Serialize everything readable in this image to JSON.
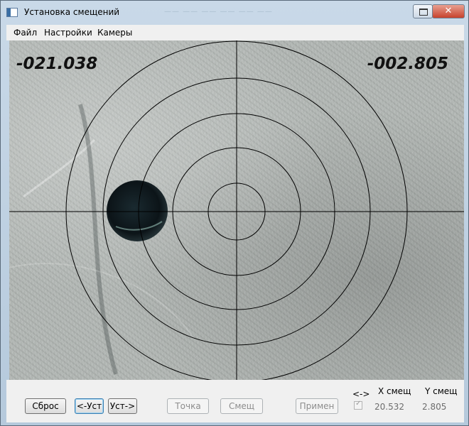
{
  "window": {
    "title": "Установка смещений",
    "close_glyph": "✕"
  },
  "menu": {
    "file": "Файл",
    "settings": "Настройки",
    "cameras": "Камеры"
  },
  "camera": {
    "x_readout": "-021.038",
    "y_readout": "-002.805",
    "overlay": "crosshair with 5 concentric target circles"
  },
  "controls": {
    "reset": "Сброс",
    "set_left": "<-Уст",
    "set_right": "Уст->",
    "point": "Точка",
    "offset": "Смещ",
    "apply": "Примен",
    "arrow_label": "<->",
    "x_offset_label": "X смещ",
    "y_offset_label": "Y смещ",
    "x_offset_value": "20.532",
    "y_offset_value": "2.805",
    "checkbox_checked": true
  },
  "icons": [
    "app-window-icon",
    "restore-icon",
    "close-icon",
    "crosshair-icon"
  ],
  "colors": {
    "titlebar": "#c9d9e8",
    "close_button": "#c7422d",
    "panel": "#f0f0f0",
    "reticle": "#000000"
  }
}
